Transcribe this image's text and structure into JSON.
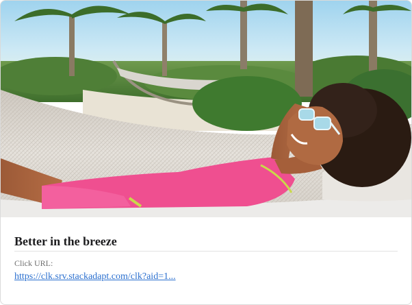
{
  "ad": {
    "image_alt": "Woman in pink shirt and sunglasses relaxing in a hammock under palm trees",
    "headline": "Better in the breeze",
    "click_url_label": "Click URL:",
    "click_url": "https://clk.srv.stackadapt.com/clk?aid=1..."
  }
}
